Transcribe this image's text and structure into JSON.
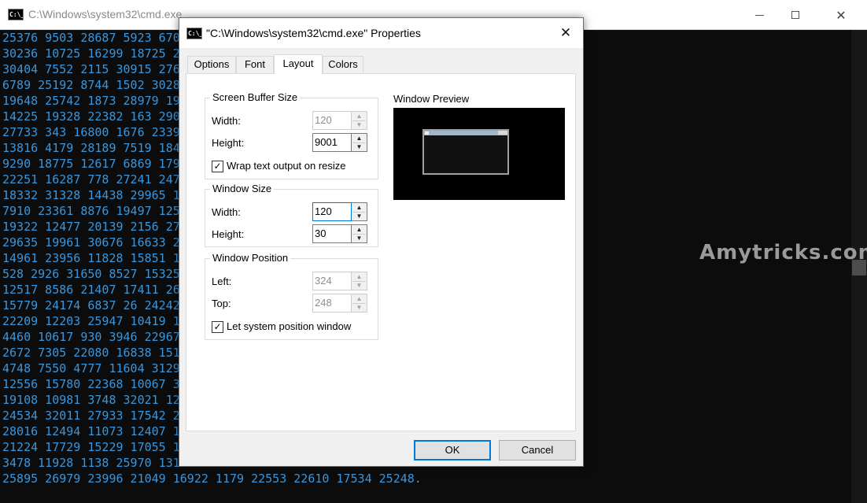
{
  "console_window": {
    "title": "C:\\Windows\\system32\\cmd.exe",
    "icon": "cmd-icon",
    "icon_text": "C:\\_",
    "controls": {
      "minimize": "minimize-icon",
      "maximize": "maximize-icon",
      "close": "close-icon"
    },
    "text_color": "#3a96dd",
    "lines": [
      "25376 9503 28687 5923 670",
      "30236 10725 16299 18725 2",
      "30404 7552 2115 30915 276",
      "6789 25192 8744 1502 3028",
      "19648 25742 1873 28979 19",
      "14225 19328 22382 163 290",
      "27733 343 16800 1676 2339",
      "13816 4179 28189 7519 184",
      "9290 18775 12617 6869 179",
      "22251 16287 778 27241 247",
      "18332 31328 14438 29965 1",
      "7910 23361 8876 19497 125",
      "19322 12477 20139 2156 27",
      "29635 19961 30676 16633 2",
      "14961 23956 11828 15851 1",
      "528 2926 31650 8527 15325",
      "12517 8586 21407 17411 26",
      "15779 24174 6837 26 24242",
      "22209 12203 25947 10419 1",
      "4460 10617 930 3946 22967",
      "2672 7305 22080 16838 151",
      "4748 7550 4777 11604 3129",
      "12556 15780 22368 10067 3",
      "19108 10981 3748 32021 12",
      "24534 32011 27933 17542 2",
      "28016 12494 11073 12407 1",
      "21224 17729 15229 17055 1",
      "3478 11928 1138 25970 131",
      "25895 26979 23996 21049 16922 1179 22553 22610 17534 25248."
    ],
    "watermark": "Amytricks.com"
  },
  "dialog": {
    "title": "\"C:\\Windows\\system32\\cmd.exe\" Properties",
    "icon_text": "C:\\_",
    "tabs": [
      {
        "label": "Options",
        "active": false
      },
      {
        "label": "Font",
        "active": false
      },
      {
        "label": "Layout",
        "active": true
      },
      {
        "label": "Colors",
        "active": false
      }
    ],
    "screen_buffer": {
      "title": "Screen Buffer Size",
      "width_label": "Width:",
      "width_value": "120",
      "height_label": "Height:",
      "height_value": "9001",
      "wrap_label": "Wrap text output on resize",
      "wrap_checked": true
    },
    "window_size": {
      "title": "Window Size",
      "width_label": "Width:",
      "width_value": "120",
      "height_label": "Height:",
      "height_value": "30"
    },
    "window_position": {
      "title": "Window Position",
      "left_label": "Left:",
      "left_value": "324",
      "top_label": "Top:",
      "top_value": "248",
      "system_label": "Let system position window",
      "system_checked": true
    },
    "preview": {
      "label": "Window Preview"
    },
    "buttons": {
      "ok": "OK",
      "cancel": "Cancel"
    },
    "check_glyph": "✓",
    "close_glyph": "✕",
    "up_glyph": "▲",
    "down_glyph": "▼",
    "accent": "#0078d7"
  }
}
